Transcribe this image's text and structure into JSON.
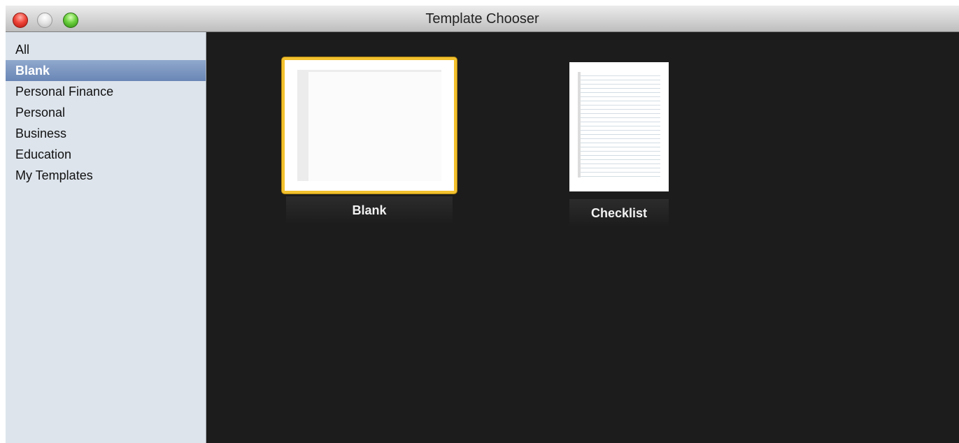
{
  "window": {
    "title": "Template Chooser"
  },
  "sidebar": {
    "items": [
      {
        "label": "All"
      },
      {
        "label": "Blank"
      },
      {
        "label": "Personal Finance"
      },
      {
        "label": "Personal"
      },
      {
        "label": "Business"
      },
      {
        "label": "Education"
      },
      {
        "label": "My Templates"
      }
    ],
    "selected": "Blank"
  },
  "templates": [
    {
      "label": "Blank",
      "selected": true
    },
    {
      "label": "Checklist",
      "selected": false
    }
  ],
  "colors": {
    "selection_border": "#f3c12e",
    "sidebar_selected": "#7b95c0",
    "sidebar_bg": "#dde4ec",
    "gallery_bg": "#1c1c1c"
  }
}
